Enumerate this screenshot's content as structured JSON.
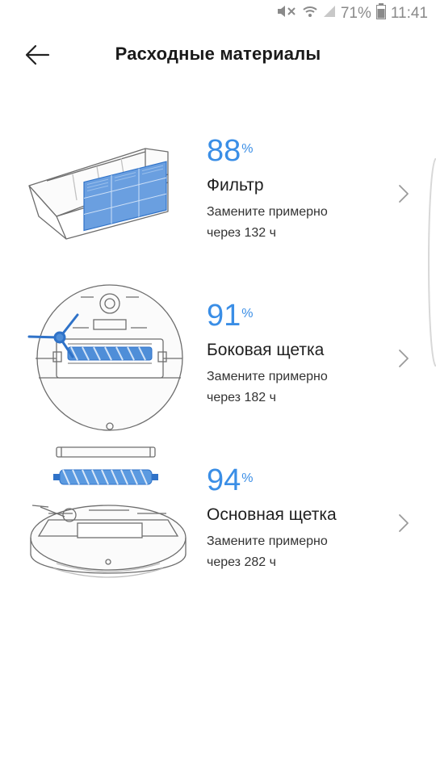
{
  "status_bar": {
    "battery_text": "71%",
    "time": "11:41",
    "icons": [
      "mute-icon",
      "wifi-icon",
      "cell-signal-icon",
      "battery-icon"
    ]
  },
  "header": {
    "title": "Расходные материалы",
    "back_icon": "back-arrow-icon"
  },
  "items": [
    {
      "percent": "88",
      "percent_sign": "%",
      "name": "Фильтр",
      "hint_line1": "Замените примерно",
      "hint_line2": "через 132 ч",
      "illustration": "filter-illustration"
    },
    {
      "percent": "91",
      "percent_sign": "%",
      "name": "Боковая щетка",
      "hint_line1": "Замените примерно",
      "hint_line2": "через 182 ч",
      "illustration": "side-brush-illustration"
    },
    {
      "percent": "94",
      "percent_sign": "%",
      "name": "Основная щетка",
      "hint_line1": "Замените примерно",
      "hint_line2": "через 282 ч",
      "illustration": "main-brush-illustration"
    }
  ],
  "colors": {
    "accent": "#3a8ee6",
    "text": "#1f1f1f",
    "line_art": "#6e6e6e"
  }
}
